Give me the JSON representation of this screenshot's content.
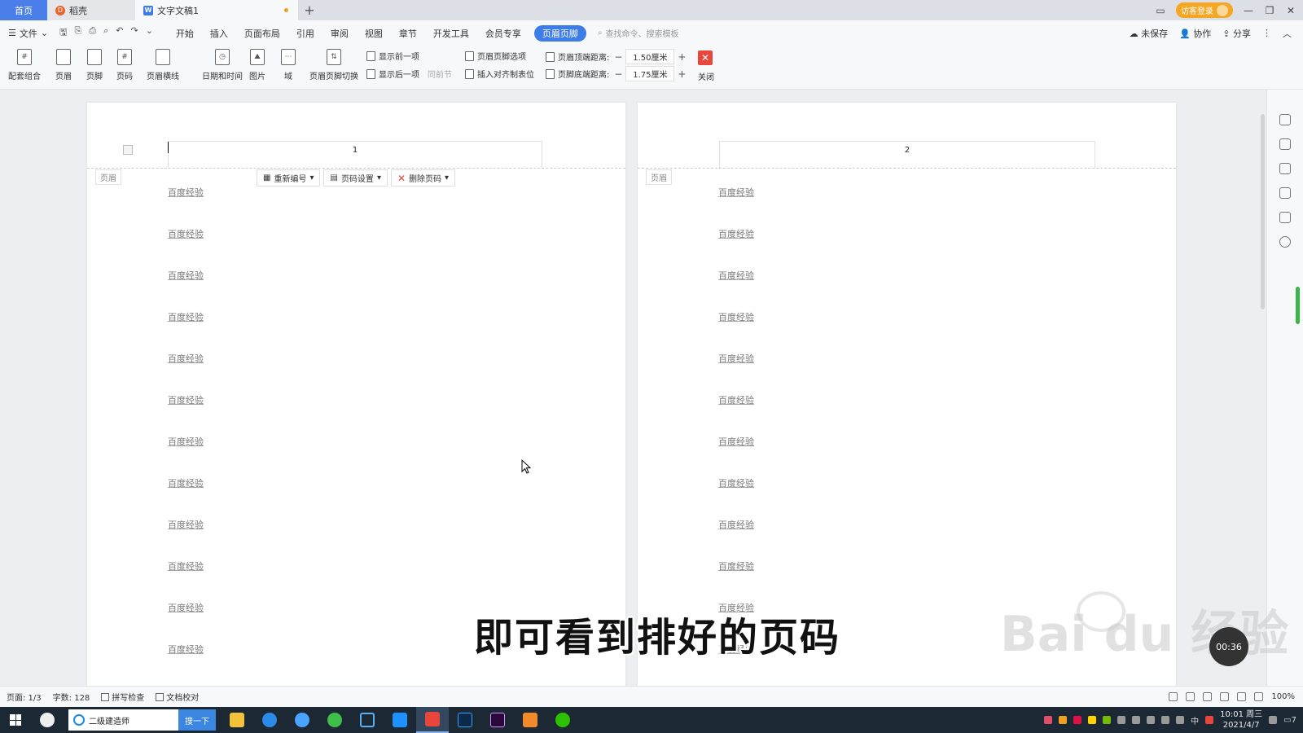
{
  "titlebar": {
    "tabs": [
      {
        "label": "首页"
      },
      {
        "label": "稻壳"
      },
      {
        "label": "文字文稿1"
      }
    ],
    "login_label": "访客登录"
  },
  "menubar": {
    "file_label": "文件",
    "items": [
      "开始",
      "插入",
      "页面布局",
      "引用",
      "审阅",
      "视图",
      "章节",
      "开发工具",
      "会员专享"
    ],
    "active_tab": "页眉页脚",
    "search_placeholder": "查找命令、搜索模板",
    "unsaved": "未保存",
    "collab": "协作",
    "share": "分享"
  },
  "ribbon": {
    "big": [
      {
        "label": "配套组合"
      },
      {
        "label": "页眉"
      },
      {
        "label": "页脚"
      },
      {
        "label": "页码"
      },
      {
        "label": "页眉横线"
      },
      {
        "label": "日期和时间"
      },
      {
        "label": "图片"
      },
      {
        "label": "域"
      },
      {
        "label": "页眉页脚切换"
      }
    ],
    "show_prev": "显示前一项",
    "show_next": "显示后一项",
    "same_prev": "同前节",
    "hf_options": "页眉页脚选项",
    "insert_tab": "插入对齐制表位",
    "header_top_label": "页眉顶端距离:",
    "header_top_value": "1.50厘米",
    "footer_bottom_label": "页脚底端距离:",
    "footer_bottom_value": "1.75厘米",
    "close_label": "关闭"
  },
  "document": {
    "page1_number": "1",
    "page2_number": "2",
    "header_tag": "页眉",
    "tools": {
      "renumber": "重新编号",
      "page_setting": "页码设置",
      "delete": "删除页码"
    },
    "line_text": "百度经验"
  },
  "status": {
    "page": "页面: 1/3",
    "words": "字数: 128",
    "spell": "拼写检查",
    "proof": "文档校对",
    "zoom": "100%"
  },
  "taskbar": {
    "search_text": "二级建造师",
    "search_btn": "搜一下",
    "time": "10:01 周三",
    "date": "2021/4/7",
    "ime": "中",
    "notif_count": "7"
  },
  "overlay": {
    "subtitle": "即可看到排好的页码",
    "watermark": "Bai du 经验",
    "timer": "00:36"
  },
  "colors": {
    "accent": "#3e7de8",
    "close": "#e8453c",
    "login": "#f5a623",
    "taskbar": "#1c2833"
  }
}
